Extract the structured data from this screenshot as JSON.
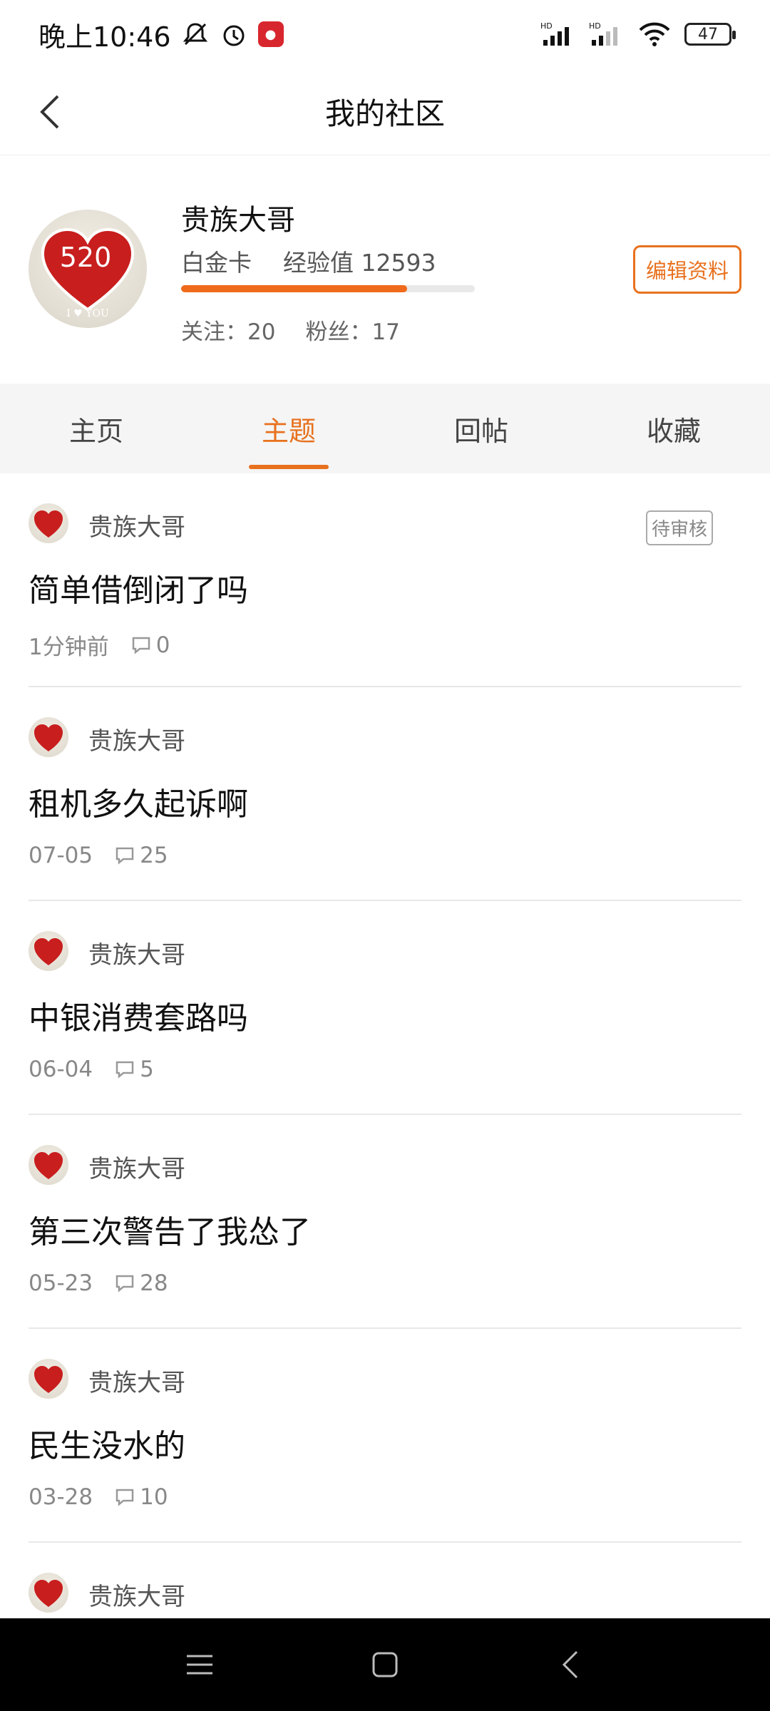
{
  "status_bar": {
    "time": "晚上10:46",
    "battery": "47",
    "hd1": "HD",
    "hd2": "HD"
  },
  "header": {
    "title": "我的社区"
  },
  "profile": {
    "name": "贵族大哥",
    "level": "白金卡",
    "experience": "经验值 12593",
    "progress": 0.77,
    "following": "关注：20",
    "followers": "粉丝：17",
    "edit_label": "编辑资料",
    "avatar_text": "520",
    "avatar_sub": "I ♥ YOU"
  },
  "tabs": [
    {
      "label": "主页",
      "active": false
    },
    {
      "label": "主题",
      "active": true
    },
    {
      "label": "回帖",
      "active": false
    },
    {
      "label": "收藏",
      "active": false
    }
  ],
  "posts": [
    {
      "author": "贵族大哥",
      "title": "简单借倒闭了吗",
      "time": "1分钟前",
      "comments": "0",
      "badge": "待审核"
    },
    {
      "author": "贵族大哥",
      "title": "租机多久起诉啊",
      "time": "07-05",
      "comments": "25"
    },
    {
      "author": "贵族大哥",
      "title": "中银消费套路吗",
      "time": "06-04",
      "comments": "5"
    },
    {
      "author": "贵族大哥",
      "title": "第三次警告了我怂了",
      "time": "05-23",
      "comments": "28"
    },
    {
      "author": "贵族大哥",
      "title": "民生没水的",
      "time": "03-28",
      "comments": "10"
    },
    {
      "author": "贵族大哥"
    }
  ],
  "colors": {
    "accent": "#e8711e",
    "progress": "#f06a1b"
  }
}
